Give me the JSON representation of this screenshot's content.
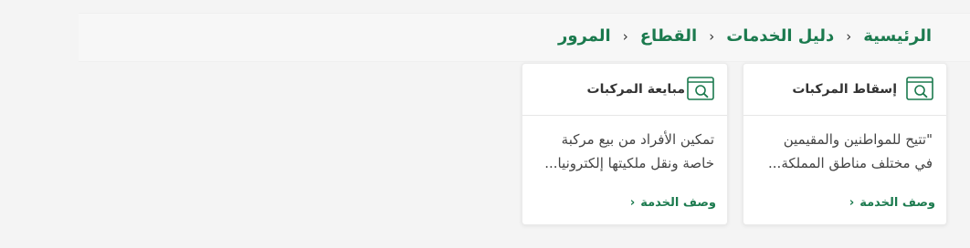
{
  "breadcrumb": {
    "items": [
      "الرئيسية",
      "دليل الخدمات",
      "القطاع",
      "المرور"
    ],
    "separator": "›"
  },
  "cards": [
    {
      "title": "إسقاط المركبات",
      "icon": "search-document-icon",
      "description_lines": [
        "\"تتيح للمواطنين والمقيمين",
        "في مختلف مناطق المملكة..."
      ],
      "link_label": "وصف الخدمة",
      "link_chevron": "›"
    },
    {
      "title": "مبايعة المركبات",
      "icon": "search-document-icon",
      "description_lines": [
        "تمكين الأفراد من بيع مركبة",
        "خاصة ونقل ملكيتها إلكترونيا..."
      ],
      "link_label": "وصف الخدمة",
      "link_chevron": "›"
    }
  ],
  "colors": {
    "accent": "#1b7a4e",
    "background": "#f4f4f4",
    "card": "#ffffff",
    "text": "#333333"
  }
}
